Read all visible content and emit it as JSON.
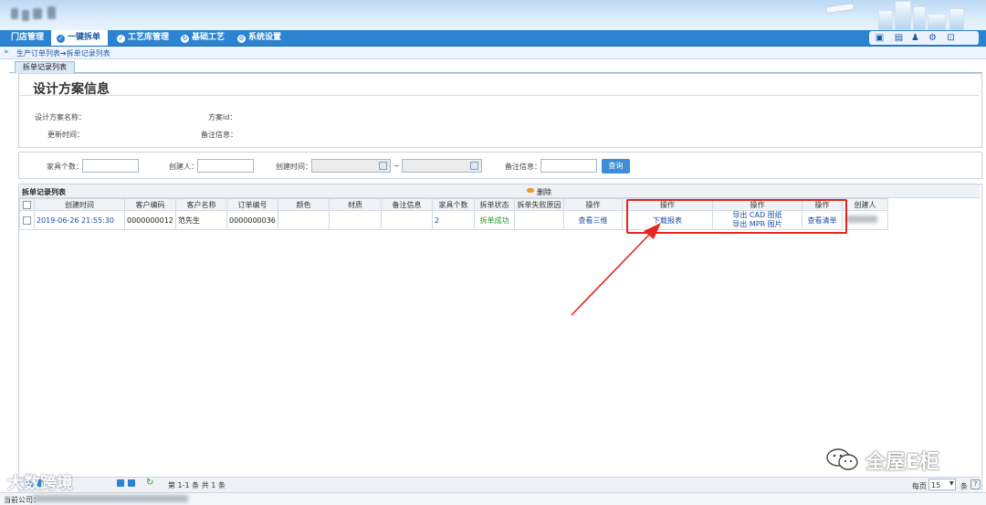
{
  "nav": {
    "tabs": [
      {
        "label": "门店管理",
        "icon": ""
      },
      {
        "label": "一键拆单",
        "icon": "check-circle-icon",
        "active": true
      },
      {
        "label": "工艺库管理",
        "icon": "check-circle-icon"
      },
      {
        "label": "基础工艺",
        "icon": "refresh-circle-icon"
      },
      {
        "label": "系统设置",
        "icon": "gear-circle-icon"
      }
    ],
    "right_icons": [
      "image-icon",
      "calendar-icon",
      "user-icon",
      "gear-icon",
      "exit-icon"
    ]
  },
  "breadcrumb": {
    "arrow": "»",
    "path": "生产订单列表➔拆单记录列表"
  },
  "tabs": [
    {
      "label": "拆单记录列表"
    }
  ],
  "design_info": {
    "title": "设计方案信息",
    "fields": {
      "name_label": "设计方案名称：",
      "id_label": "方案id：",
      "update_time_label": "更新时间：",
      "remark_label": "备注信息："
    }
  },
  "filter": {
    "furniture_count_label": "家具个数：",
    "creator_label": "创建人：",
    "create_time_label": "创建时间：",
    "range_sep": "~",
    "remark_label": "备注信息：",
    "search_label": "查询"
  },
  "grid": {
    "title": "拆单记录列表",
    "delete_label": "删除",
    "columns": [
      "创建时间",
      "客户编码",
      "客户名称",
      "订单编号",
      "颜色",
      "材质",
      "备注信息",
      "家具个数",
      "拆单状态",
      "拆单失败原因",
      "操作",
      "操作",
      "操作",
      "操作",
      "创建人"
    ],
    "rows": [
      {
        "create_time": "2019-06-26 21:55:30",
        "customer_code": "0000000012",
        "customer_name": "范先生",
        "order_no": "0000000036",
        "color": "",
        "material": "",
        "remark": "",
        "furniture_count": "2",
        "status": "拆单成功",
        "fail_reason": "",
        "op_view3d": "查看三维",
        "op_download": "下载报表",
        "op_export_cad": "导出 CAD 图纸",
        "op_export_mpr": "导出 MPR 图片",
        "op_view_list": "查看清单"
      }
    ]
  },
  "pager": {
    "page_info": "第 1-1 条   共 1 条",
    "per_page_label": "每页",
    "per_page_value": "15",
    "per_page_unit": "条"
  },
  "status_bar": {
    "company_label": "当前公司："
  },
  "watermarks": {
    "left": "大数跨境",
    "right": "全屋E柜"
  },
  "colors": {
    "nav": "#2b83d1",
    "highlight": "#e8261f",
    "link": "#1d4fa5",
    "success": "#1c9a1c"
  }
}
